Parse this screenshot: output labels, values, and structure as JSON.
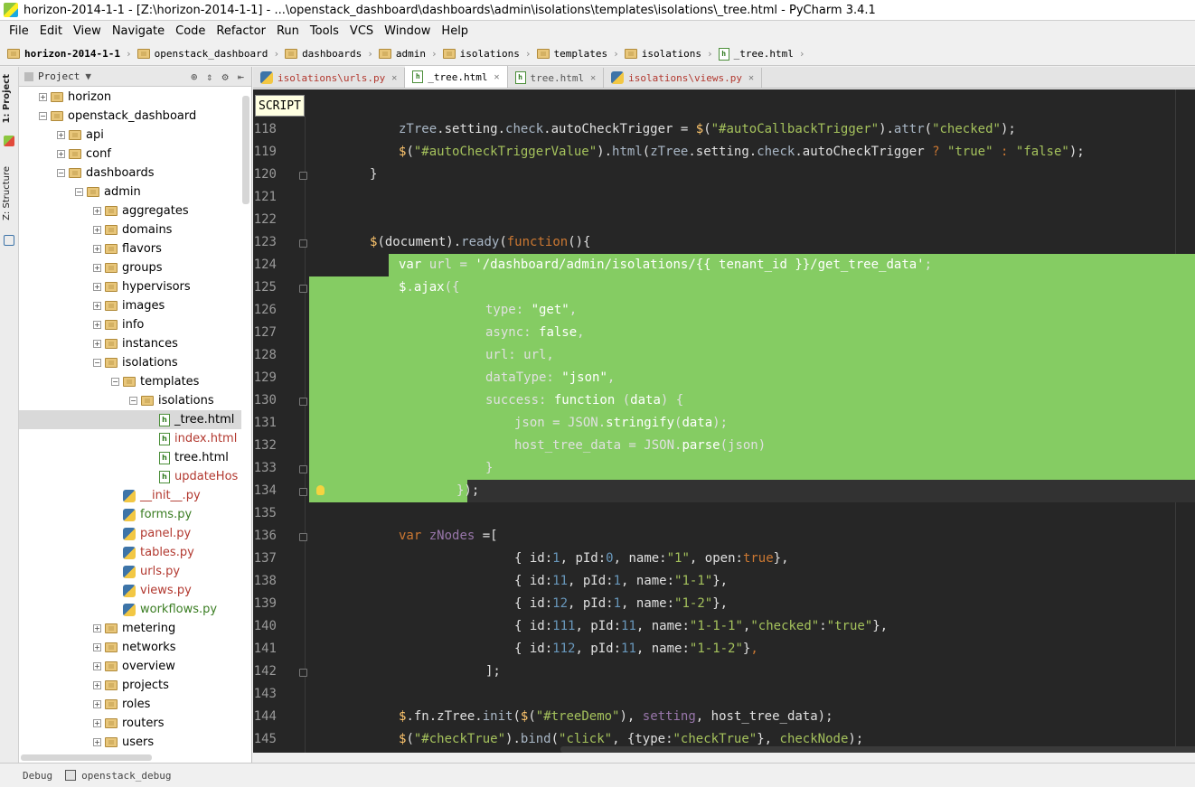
{
  "window": {
    "title": "horizon-2014-1-1 - [Z:\\horizon-2014-1-1] - ...\\openstack_dashboard\\dashboards\\admin\\isolations\\templates\\isolations\\_tree.html - PyCharm 3.4.1"
  },
  "menu": [
    "File",
    "Edit",
    "View",
    "Navigate",
    "Code",
    "Refactor",
    "Run",
    "Tools",
    "VCS",
    "Window",
    "Help"
  ],
  "breadcrumb": [
    {
      "label": "horizon-2014-1-1",
      "icon": "folder-icon"
    },
    {
      "label": "openstack_dashboard",
      "icon": "folder-icon"
    },
    {
      "label": "dashboards",
      "icon": "folder-icon"
    },
    {
      "label": "admin",
      "icon": "folder-icon"
    },
    {
      "label": "isolations",
      "icon": "folder-icon"
    },
    {
      "label": "templates",
      "icon": "folder-icon"
    },
    {
      "label": "isolations",
      "icon": "folder-icon"
    },
    {
      "label": "_tree.html",
      "icon": "html-file-icon"
    }
  ],
  "side_tabs": {
    "project": "1: Project",
    "structure": "Z: Structure"
  },
  "project_panel": {
    "title": "Project"
  },
  "tree": [
    {
      "label": "horizon",
      "type": "folder",
      "depth": 1,
      "exp": "+"
    },
    {
      "label": "openstack_dashboard",
      "type": "folder",
      "depth": 1,
      "exp": "-"
    },
    {
      "label": "api",
      "type": "folder",
      "depth": 2,
      "exp": "+"
    },
    {
      "label": "conf",
      "type": "folder",
      "depth": 2,
      "exp": "+"
    },
    {
      "label": "dashboards",
      "type": "folder",
      "depth": 2,
      "exp": "-"
    },
    {
      "label": "admin",
      "type": "folder",
      "depth": 3,
      "exp": "-"
    },
    {
      "label": "aggregates",
      "type": "folder",
      "depth": 4,
      "exp": "+"
    },
    {
      "label": "domains",
      "type": "folder",
      "depth": 4,
      "exp": "+"
    },
    {
      "label": "flavors",
      "type": "folder",
      "depth": 4,
      "exp": "+"
    },
    {
      "label": "groups",
      "type": "folder",
      "depth": 4,
      "exp": "+"
    },
    {
      "label": "hypervisors",
      "type": "folder",
      "depth": 4,
      "exp": "+"
    },
    {
      "label": "images",
      "type": "folder",
      "depth": 4,
      "exp": "+"
    },
    {
      "label": "info",
      "type": "folder",
      "depth": 4,
      "exp": "+"
    },
    {
      "label": "instances",
      "type": "folder",
      "depth": 4,
      "exp": "+"
    },
    {
      "label": "isolations",
      "type": "folder",
      "depth": 4,
      "exp": "-"
    },
    {
      "label": "templates",
      "type": "folder",
      "depth": 5,
      "exp": "-"
    },
    {
      "label": "isolations",
      "type": "folder",
      "depth": 6,
      "exp": "-"
    },
    {
      "label": "_tree.html",
      "type": "html",
      "depth": 7,
      "exp": "",
      "selected": true
    },
    {
      "label": "index.html",
      "type": "html",
      "depth": 7,
      "exp": "",
      "color": "red"
    },
    {
      "label": "tree.html",
      "type": "html",
      "depth": 7,
      "exp": ""
    },
    {
      "label": "updateHos",
      "type": "html",
      "depth": 7,
      "exp": "",
      "color": "red"
    },
    {
      "label": "__init__.py",
      "type": "py",
      "depth": 5,
      "exp": "",
      "color": "red"
    },
    {
      "label": "forms.py",
      "type": "py",
      "depth": 5,
      "exp": "",
      "color": "green"
    },
    {
      "label": "panel.py",
      "type": "py",
      "depth": 5,
      "exp": "",
      "color": "red"
    },
    {
      "label": "tables.py",
      "type": "py",
      "depth": 5,
      "exp": "",
      "color": "red"
    },
    {
      "label": "urls.py",
      "type": "py",
      "depth": 5,
      "exp": "",
      "color": "red"
    },
    {
      "label": "views.py",
      "type": "py",
      "depth": 5,
      "exp": "",
      "color": "red"
    },
    {
      "label": "workflows.py",
      "type": "py",
      "depth": 5,
      "exp": "",
      "color": "green"
    },
    {
      "label": "metering",
      "type": "folder",
      "depth": 4,
      "exp": "+"
    },
    {
      "label": "networks",
      "type": "folder",
      "depth": 4,
      "exp": "+"
    },
    {
      "label": "overview",
      "type": "folder",
      "depth": 4,
      "exp": "+"
    },
    {
      "label": "projects",
      "type": "folder",
      "depth": 4,
      "exp": "+"
    },
    {
      "label": "roles",
      "type": "folder",
      "depth": 4,
      "exp": "+"
    },
    {
      "label": "routers",
      "type": "folder",
      "depth": 4,
      "exp": "+"
    },
    {
      "label": "users",
      "type": "folder",
      "depth": 4,
      "exp": "+"
    }
  ],
  "tabs": [
    {
      "label": "isolations\\urls.py",
      "icon": "python-file-icon",
      "active": false
    },
    {
      "label": "_tree.html",
      "icon": "html-file-icon",
      "active": true
    },
    {
      "label": "tree.html",
      "icon": "html-file-icon",
      "active": false
    },
    {
      "label": "isolations\\views.py",
      "icon": "python-file-icon",
      "active": false
    }
  ],
  "editor": {
    "context_label": "SCRIPT",
    "lines": [
      {
        "n": 118,
        "html": "<span class='w'>zTree</span><span class='d'>.setting.</span><span class='w'>check</span><span class='d'>.autoCheckTrigger = </span><span class='f'>$</span><span class='d'>(</span><span class='s'>\"#autoCallbackTrigger\"</span><span class='d'>).</span><span class='w'>attr</span><span class='d'>(</span><span class='s'>\"checked\"</span><span class='d'>);</span>",
        "indent": 5
      },
      {
        "n": 119,
        "html": "<span class='f'>$</span><span class='d'>(</span><span class='s'>\"#autoCheckTriggerValue\"</span><span class='d'>).</span><span class='w'>html</span><span class='d'>(</span><span class='w'>zTree</span><span class='d'>.setting.</span><span class='w'>check</span><span class='d'>.autoCheckTrigger </span><span class='k'>?</span><span class='d'> </span><span class='s'>\"true\"</span><span class='d'> </span><span class='k'>:</span><span class='d'> </span><span class='s'>\"false\"</span><span class='d'>);</span>",
        "indent": 5
      },
      {
        "n": 120,
        "html": "<span class='d'>}</span>",
        "indent": 4,
        "fold": true
      },
      {
        "n": 121,
        "html": "",
        "indent": 0
      },
      {
        "n": 122,
        "html": "",
        "indent": 0
      },
      {
        "n": 123,
        "html": "<span class='f'>$</span><span class='d'>(document).</span><span class='w'>ready</span><span class='d'>(</span><span class='k'>function</span><span class='d'>(){</span>",
        "indent": 4,
        "fold": true
      },
      {
        "n": 124,
        "html": "<span class='k'>var</span><span class='d'> url = </span><span class='s'>'/dashboard/admin/isolations/{{ tenant_id }}/get_tree_data'</span><span class='d'>;</span>",
        "indent": 5
      },
      {
        "n": 125,
        "html": "<span class='f'>$</span><span class='d'>.</span><span class='w'>ajax</span><span class='d'>({</span>",
        "indent": 5,
        "fold": true
      },
      {
        "n": 126,
        "html": "<span class='d'>type: </span><span class='s'>\"get\"</span><span class='d'>,</span>",
        "indent": 8
      },
      {
        "n": 127,
        "html": "<span class='d'>async: </span><span class='k'>false</span><span class='d'>,</span>",
        "indent": 8
      },
      {
        "n": 128,
        "html": "<span class='d'>url: url,</span>",
        "indent": 8
      },
      {
        "n": 129,
        "html": "<span class='d'>dataType: </span><span class='s'>\"json\"</span><span class='d'>,</span>",
        "indent": 8
      },
      {
        "n": 130,
        "html": "<span class='d'>success: </span><span class='k'>function</span><span class='d'> (</span><span class='p'>data</span><span class='d'>) {</span>",
        "indent": 8,
        "fold": true
      },
      {
        "n": 131,
        "html": "<span class='d'>json = JSON.</span><span class='w'>stringify</span><span class='d'>(</span><span class='p'>data</span><span class='d'>);</span>",
        "indent": 9
      },
      {
        "n": 132,
        "html": "<span class='d'>host_tree_data = JSON.</span><span class='w'>parse</span><span class='d'>(json)</span>",
        "indent": 9
      },
      {
        "n": 133,
        "html": "<span class='d'>}</span>",
        "indent": 8,
        "fold": true
      },
      {
        "n": 134,
        "html": "<span class='d'>});</span>",
        "indent": 7,
        "fold": true,
        "bulb": true
      },
      {
        "n": 135,
        "html": "",
        "indent": 0
      },
      {
        "n": 136,
        "html": "<span class='k'>var</span><span class='d'> </span><span class='p'>zNodes</span><span class='d'> =[</span>",
        "indent": 5,
        "fold": true
      },
      {
        "n": 137,
        "html": "<span class='d'>{ id:</span><span class='n'>1</span><span class='d'>, pId:</span><span class='n'>0</span><span class='d'>, name:</span><span class='s'>\"1\"</span><span class='d'>, open:</span><span class='k'>true</span><span class='d'>},</span>",
        "indent": 9
      },
      {
        "n": 138,
        "html": "<span class='d'>{ id:</span><span class='n'>11</span><span class='d'>, pId:</span><span class='n'>1</span><span class='d'>, name:</span><span class='s'>\"1-1\"</span><span class='d'>},</span>",
        "indent": 9
      },
      {
        "n": 139,
        "html": "<span class='d'>{ id:</span><span class='n'>12</span><span class='d'>, pId:</span><span class='n'>1</span><span class='d'>, name:</span><span class='s'>\"1-2\"</span><span class='d'>},</span>",
        "indent": 9
      },
      {
        "n": 140,
        "html": "<span class='d'>{ id:</span><span class='n'>111</span><span class='d'>, pId:</span><span class='n'>11</span><span class='d'>, name:</span><span class='s'>\"1-1-1\"</span><span class='d'>,</span><span class='s'>\"checked\"</span><span class='d'>:</span><span class='s'>\"true\"</span><span class='d'>},</span>",
        "indent": 9
      },
      {
        "n": 141,
        "html": "<span class='d'>{ id:</span><span class='n'>112</span><span class='d'>, pId:</span><span class='n'>11</span><span class='d'>, name:</span><span class='s'>\"1-1-2\"</span><span class='d'>}</span><span class='k'>,</span>",
        "indent": 9
      },
      {
        "n": 142,
        "html": "<span class='d'>];</span>",
        "indent": 8,
        "fold": true
      },
      {
        "n": 143,
        "html": "",
        "indent": 0
      },
      {
        "n": 144,
        "html": "<span class='f'>$</span><span class='d'>.fn.zTree.</span><span class='w'>init</span><span class='d'>(</span><span class='f'>$</span><span class='d'>(</span><span class='s'>\"#treeDemo\"</span><span class='d'>), </span><span class='p'>setting</span><span class='d'>, host_tree_data);</span>",
        "indent": 5
      },
      {
        "n": 145,
        "html": "<span class='f'>$</span><span class='d'>(</span><span class='s'>\"#checkTrue\"</span><span class='d'>).</span><span class='w'>bind</span><span class='d'>(</span><span class='s'>\"click\"</span><span class='d'>, {type:</span><span class='s'>\"checkTrue\"</span><span class='d'>}, </span><span class='s'>checkNode</span><span class='d'>);</span>",
        "indent": 5
      }
    ]
  },
  "status": {
    "debug": "Debug",
    "config": "openstack_debug"
  }
}
